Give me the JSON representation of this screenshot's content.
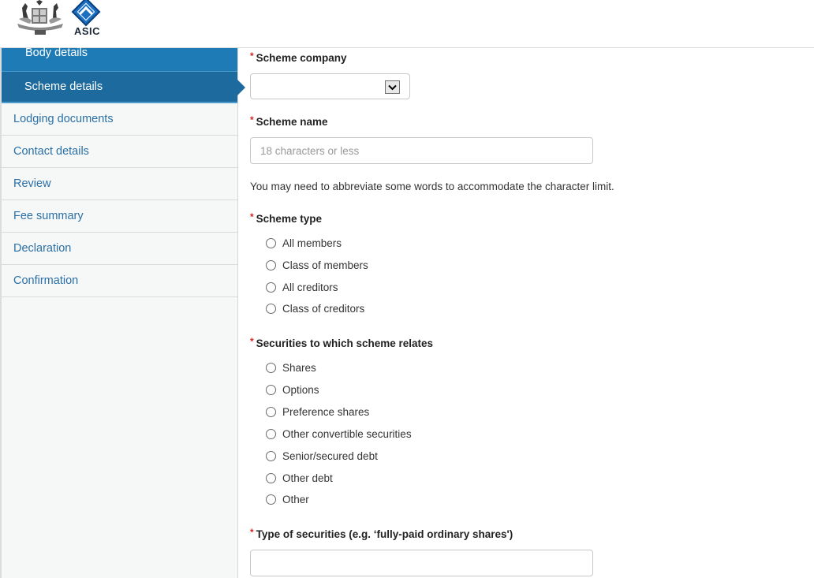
{
  "header": {
    "crest_logo": "australian-coat-of-arms",
    "brand_logo_text": "ASIC"
  },
  "sidebar": {
    "items": [
      {
        "label": "Body details",
        "state": "completed"
      },
      {
        "label": "Scheme details",
        "state": "active"
      },
      {
        "label": "Lodging documents",
        "state": "pending"
      },
      {
        "label": "Contact details",
        "state": "pending"
      },
      {
        "label": "Review",
        "state": "pending"
      },
      {
        "label": "Fee summary",
        "state": "pending"
      },
      {
        "label": "Declaration",
        "state": "pending"
      },
      {
        "label": "Confirmation",
        "state": "pending"
      }
    ]
  },
  "form": {
    "required_marker": "*",
    "scheme_company": {
      "label": "Scheme company",
      "value": ""
    },
    "scheme_name": {
      "label": "Scheme name",
      "value": "",
      "placeholder": "18 characters or less"
    },
    "help_text": "You may need to abbreviate some words to accommodate the character limit.",
    "scheme_type": {
      "label": "Scheme type",
      "options": [
        "All members",
        "Class of members",
        "All creditors",
        "Class of creditors"
      ],
      "selected": null
    },
    "securities": {
      "label": "Securities to which scheme relates",
      "options": [
        "Shares",
        "Options",
        "Preference shares",
        "Other convertible securities",
        "Senior/secured debt",
        "Other debt",
        "Other"
      ],
      "selected": null
    },
    "type_of_securities": {
      "label": "Type of securities (e.g. ‘fully-paid ordinary shares')",
      "value": ""
    }
  },
  "colors": {
    "nav_completed": "#1e7bb6",
    "nav_active": "#1c6a9e",
    "nav_link": "#2a6fa5",
    "required": "#e02020"
  }
}
